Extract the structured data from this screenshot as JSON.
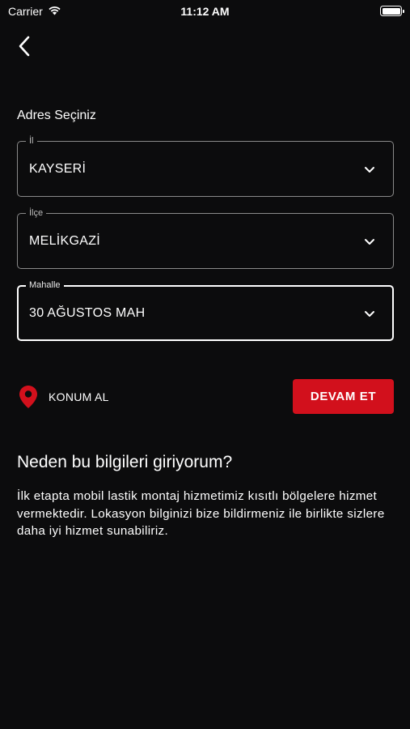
{
  "status_bar": {
    "carrier": "Carrier",
    "time": "11:12 AM",
    "wifi_icon": "wifi-icon",
    "battery_icon": "battery-icon"
  },
  "nav": {
    "back_icon": "chevron-left-icon"
  },
  "form": {
    "title": "Adres Seçiniz",
    "fields": [
      {
        "legend": "İl",
        "value": "KAYSERİ",
        "icon": "chevron-down-icon"
      },
      {
        "legend": "İlçe",
        "value": "MELİKGAZİ",
        "icon": "chevron-down-icon"
      },
      {
        "legend": "Mahalle",
        "value": "30 AĞUSTOS MAH",
        "icon": "chevron-down-icon",
        "focused": true
      }
    ]
  },
  "actions": {
    "location_label": "KONUM AL",
    "location_icon": "map-pin-icon",
    "continue_label": "DEVAM ET"
  },
  "info": {
    "title": "Neden bu bilgileri giriyorum?",
    "text": "İlk etapta mobil lastik montaj hizmetimiz kısıtlı bölgelere hizmet vermektedir. Lokasyon bilginizi bize bildirmeniz ile birlikte sizlere daha iyi hizmet sunabiliriz."
  },
  "colors": {
    "background": "#0c0c0d",
    "accent": "#d2101c",
    "text": "#ffffff",
    "border": "#8a8a8a"
  }
}
